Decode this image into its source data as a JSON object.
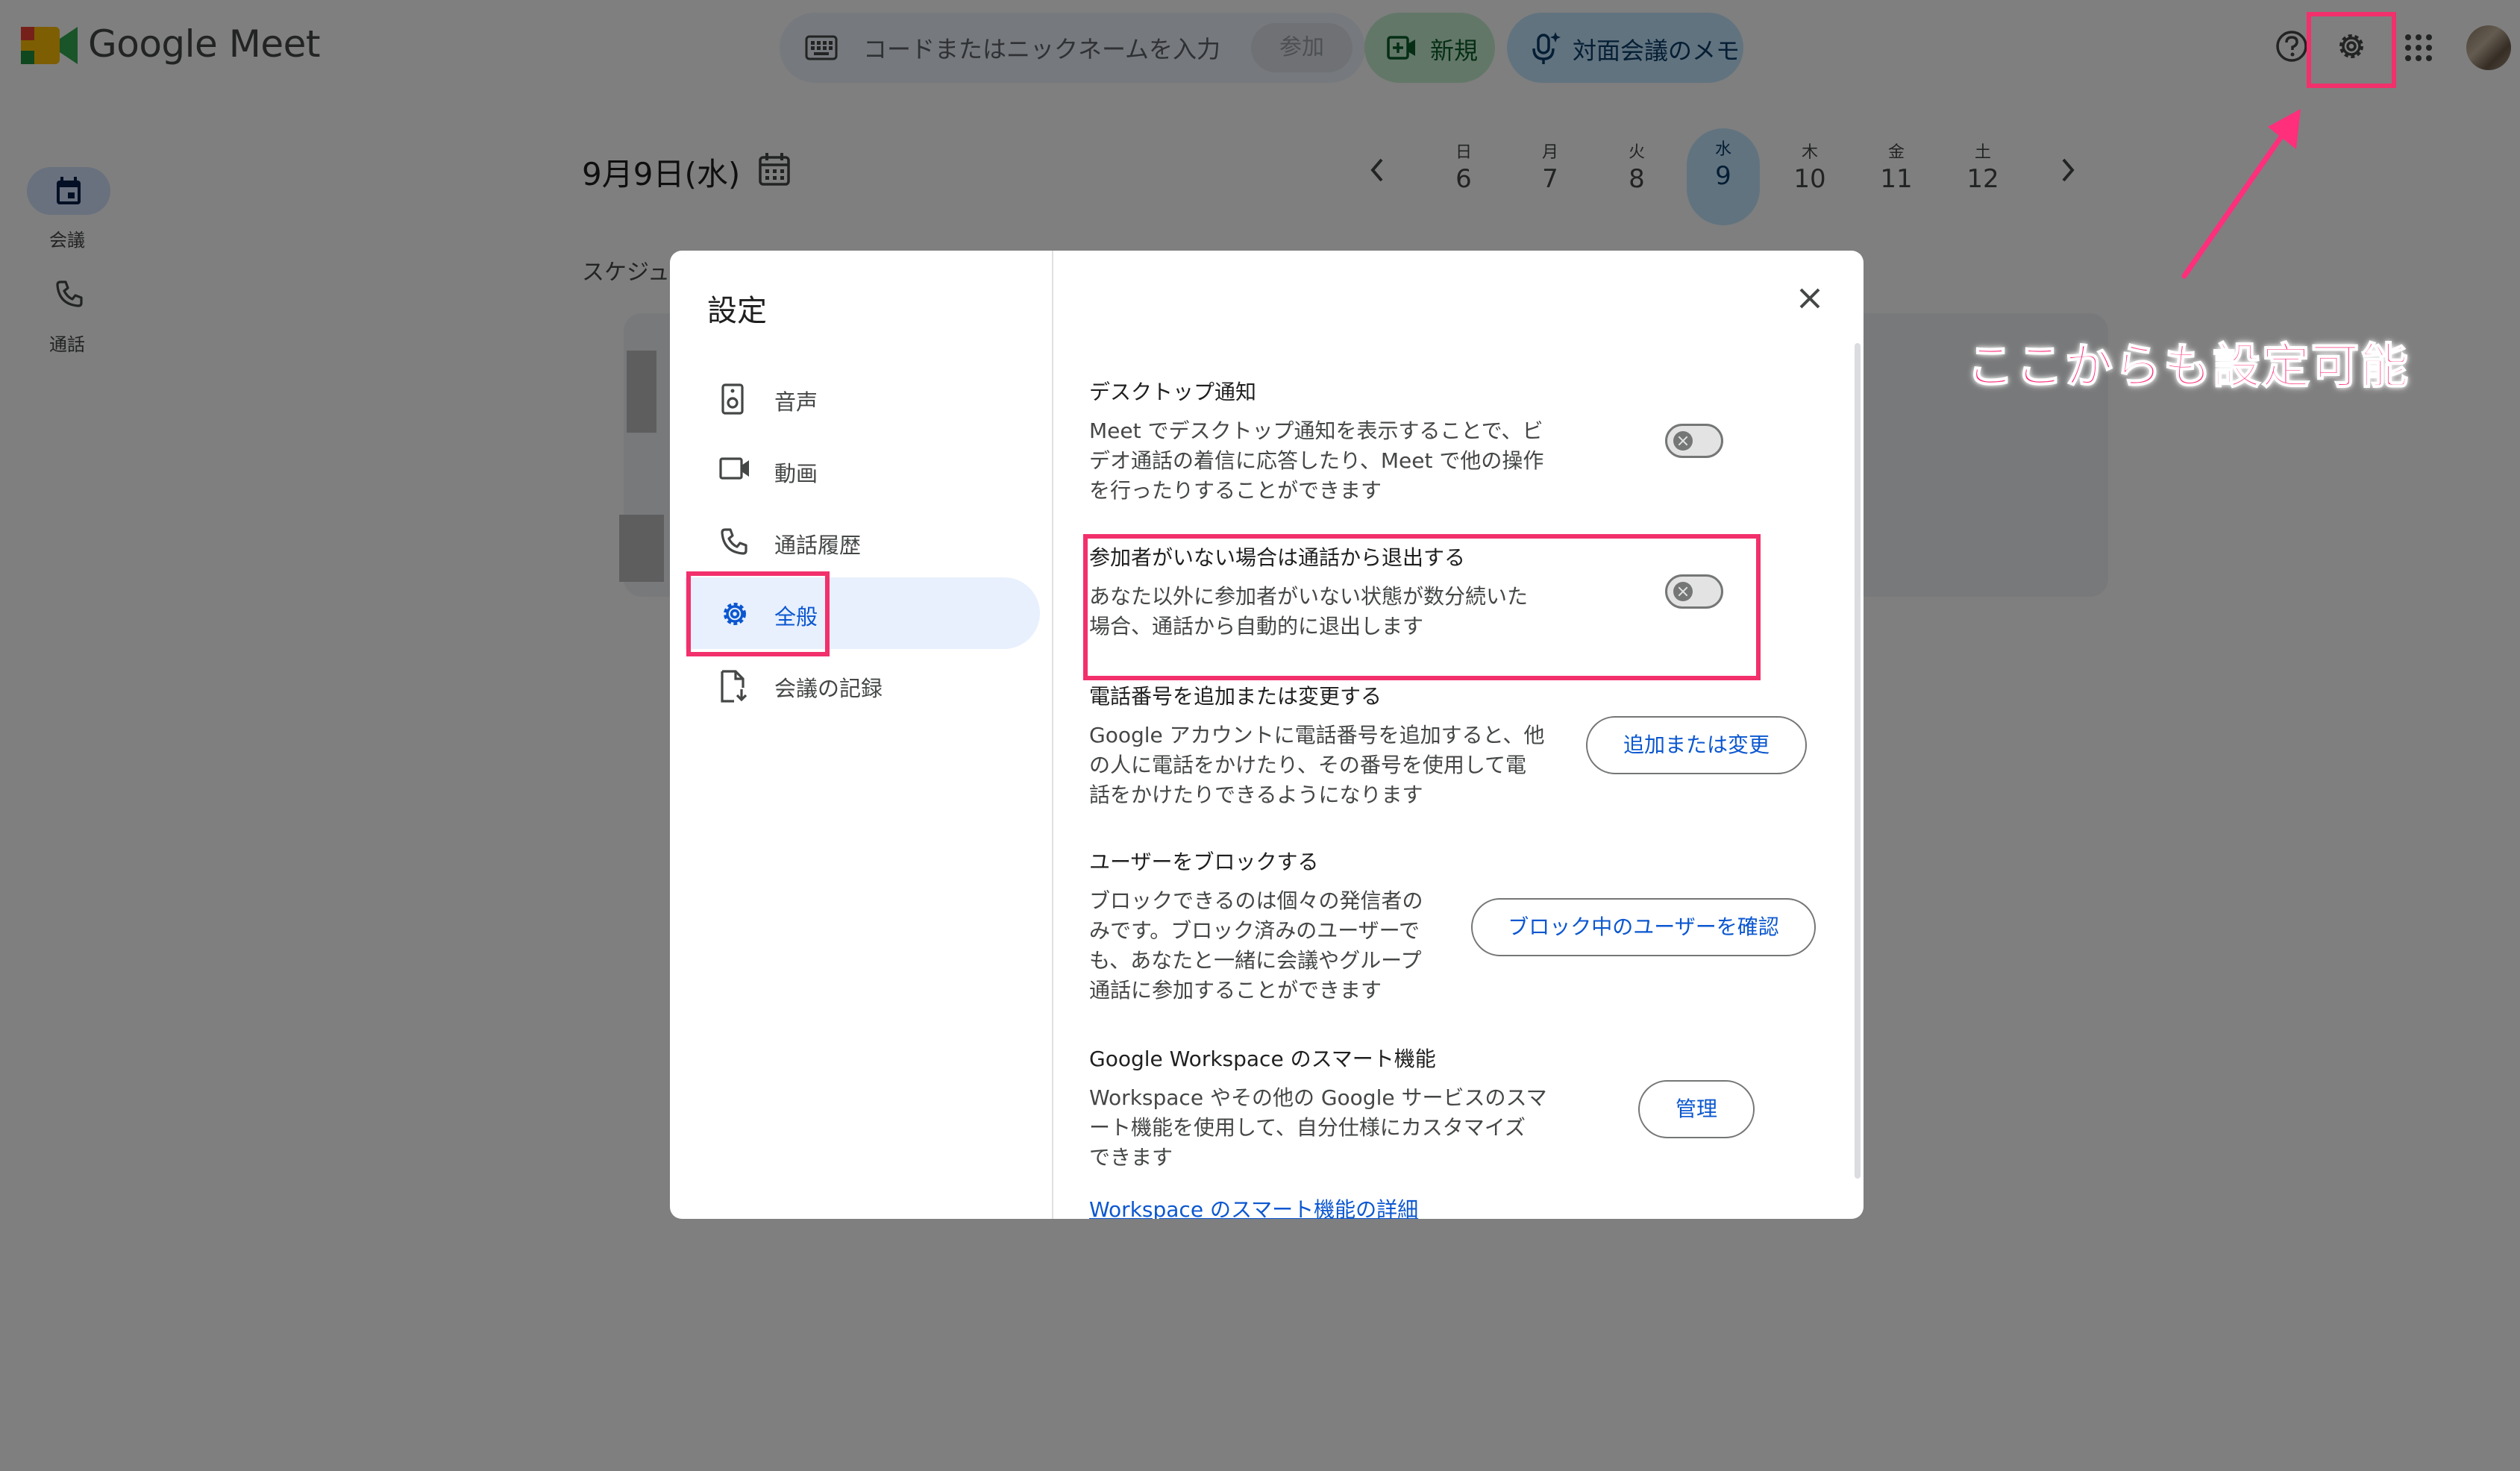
{
  "app": {
    "name": "Google Meet"
  },
  "topbar": {
    "search_placeholder": "コードまたはニックネームを入力",
    "join_label": "参加",
    "new_label": "新規",
    "memo_label": "対面会議のメモ"
  },
  "rail": {
    "meetings_label": "会議",
    "calls_label": "通話"
  },
  "calendar": {
    "date_title": "9月9日(水)",
    "schedule_label": "スケジュ",
    "days": [
      {
        "dow": "日",
        "num": "6"
      },
      {
        "dow": "月",
        "num": "7"
      },
      {
        "dow": "火",
        "num": "8"
      },
      {
        "dow": "水",
        "num": "9",
        "selected": true
      },
      {
        "dow": "木",
        "num": "10"
      },
      {
        "dow": "金",
        "num": "11"
      },
      {
        "dow": "土",
        "num": "12"
      }
    ]
  },
  "dialog": {
    "title": "設定",
    "nav": [
      {
        "label": "音声",
        "icon": "speaker-icon"
      },
      {
        "label": "動画",
        "icon": "video-icon"
      },
      {
        "label": "通話履歴",
        "icon": "phone-icon"
      },
      {
        "label": "全般",
        "icon": "gear-icon",
        "active": true
      },
      {
        "label": "会議の記録",
        "icon": "file-download-icon"
      }
    ],
    "sections": {
      "desktop": {
        "heading": "デスクトップ通知",
        "desc1": "Meet でデスクトップ通知を表示することで、ビ",
        "desc2": "デオ通話の着信に応答したり、Meet で他の操作",
        "desc3": "を行ったりすることができます",
        "toggle_on": false
      },
      "leave": {
        "heading": "参加者がいない場合は通話から退出する",
        "desc1": "あなた以外に参加者がいない状態が数分続いた",
        "desc2": "場合、通話から自動的に退出します",
        "toggle_on": false
      },
      "phone": {
        "heading": "電話番号を追加または変更する",
        "desc1": "Google アカウントに電話番号を追加すると、他",
        "desc2": "の人に電話をかけたり、その番号を使用して電",
        "desc3": "話をかけたりできるようになります",
        "button": "追加または変更"
      },
      "block": {
        "heading": "ユーザーをブロックする",
        "desc1": "ブロックできるのは個々の発信者の",
        "desc2": "みです。ブロック済みのユーザーで",
        "desc3": "も、あなたと一緒に会議やグループ",
        "desc4": "通話に参加することができます",
        "button": "ブロック中のユーザーを確認"
      },
      "workspace": {
        "heading": "Google Workspace のスマート機能",
        "desc1": "Workspace やその他の Google サービスのスマ",
        "desc2": "ート機能を使用して、自分仕様にカスタマイズ",
        "desc3": "できます",
        "button": "管理",
        "link": "Workspace のスマート機能の詳細"
      }
    }
  },
  "annotation": {
    "text": "ここからも設定可能",
    "color": "#ff2f7c"
  }
}
